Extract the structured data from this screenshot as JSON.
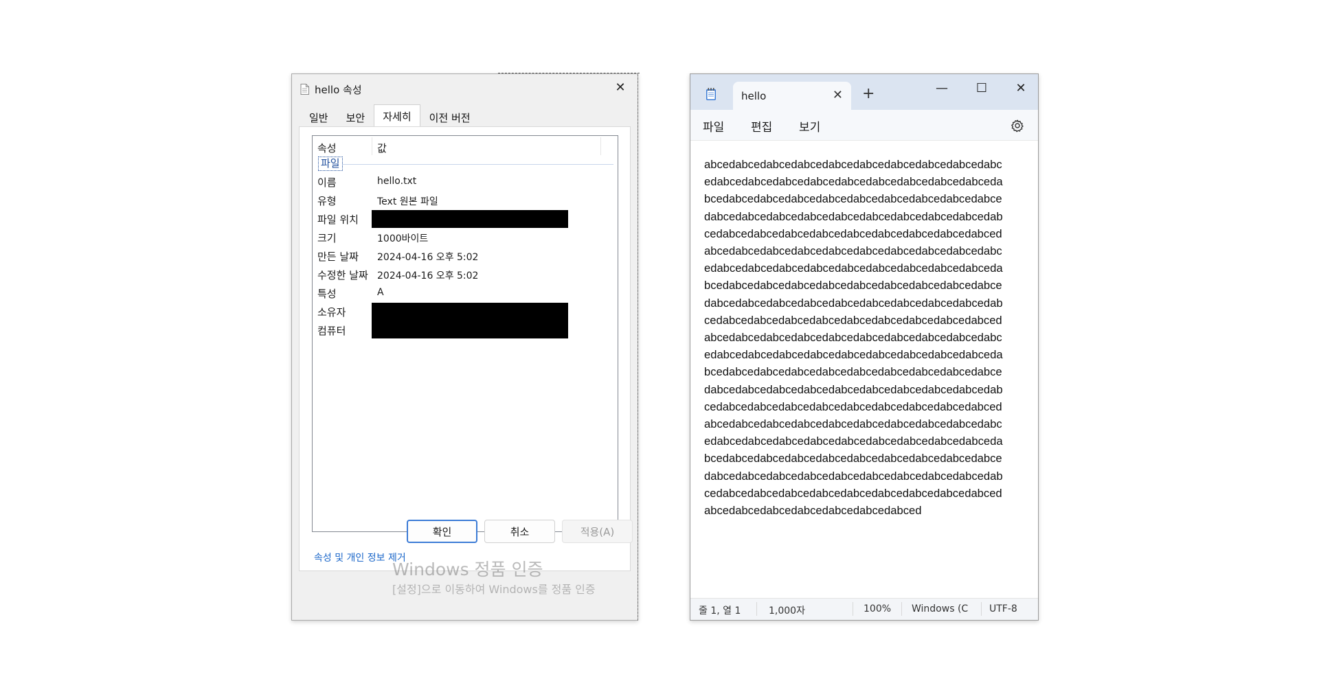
{
  "properties_dialog": {
    "title": "hello 속성",
    "close_glyph": "✕",
    "tabs": [
      {
        "label": "일반"
      },
      {
        "label": "보안"
      },
      {
        "label": "자세히"
      },
      {
        "label": "이전 버전"
      }
    ],
    "active_tab": "자세히",
    "columns": {
      "property": "속성",
      "value": "값"
    },
    "group_label": "파일",
    "rows": [
      {
        "key": "이름",
        "value": "hello.txt"
      },
      {
        "key": "유형",
        "value": "Text 원본 파일"
      },
      {
        "key": "파일 위치",
        "value": ""
      },
      {
        "key": "크기",
        "value": "1000바이트"
      },
      {
        "key": "만든 날짜",
        "value": "2024-04-16 오후 5:02"
      },
      {
        "key": "수정한 날짜",
        "value": "2024-04-16 오후 5:02"
      },
      {
        "key": "특성",
        "value": "A"
      },
      {
        "key": "소유자",
        "value": ""
      },
      {
        "key": "컴퓨터",
        "value": ""
      }
    ],
    "remove_link": "속성 및 개인 정보 제거",
    "buttons": {
      "ok": "확인",
      "cancel": "취소",
      "apply": "적용(A)"
    }
  },
  "watermark": {
    "line1": "Windows 정품 인증",
    "line2": "[설정]으로 이동하여 Windows를 정품 인증"
  },
  "notepad": {
    "tab_title": "hello",
    "tab_close_glyph": "✕",
    "new_tab_glyph": "+",
    "window_controls": {
      "minimize": "—",
      "maximize": "☐",
      "close": "✕"
    },
    "menus": [
      "파일",
      "편집",
      "보기"
    ],
    "text_lines": [
      "abcedabcedabcedabcedabcedabcedabcedabcedabcedabc",
      "edabcedabcedabcedabcedabcedabcedabcedabcedabceda",
      "bcedabcedabcedabcedabcedabcedabcedabcedabcedabce",
      "dabcedabcedabcedabcedabcedabcedabcedabcedabcedab",
      "cedabcedabcedabcedabcedabcedabcedabcedabcedabced",
      "abcedabcedabcedabcedabcedabcedabcedabcedabcedabc",
      "edabcedabcedabcedabcedabcedabcedabcedabcedabceda",
      "bcedabcedabcedabcedabcedabcedabcedabcedabcedabce",
      "dabcedabcedabcedabcedabcedabcedabcedabcedabcedab",
      "cedabcedabcedabcedabcedabcedabcedabcedabcedabced",
      "abcedabcedabcedabcedabcedabcedabcedabcedabcedabc",
      "edabcedabcedabcedabcedabcedabcedabcedabcedabceda",
      "bcedabcedabcedabcedabcedabcedabcedabcedabcedabce",
      "dabcedabcedabcedabcedabcedabcedabcedabcedabcedab",
      "cedabcedabcedabcedabcedabcedabcedabcedabcedabced",
      "abcedabcedabcedabcedabcedabcedabcedabcedabcedabc",
      "edabcedabcedabcedabcedabcedabcedabcedabcedabceda",
      "bcedabcedabcedabcedabcedabcedabcedabcedabcedabce",
      "dabcedabcedabcedabcedabcedabcedabcedabcedabcedab",
      "cedabcedabcedabcedabcedabcedabcedabcedabcedabced",
      "abcedabcedabcedabcedabcedabcedabced"
    ],
    "status": {
      "position": "줄 1, 열 1",
      "chars": "1,000자",
      "zoom": "100%",
      "line_ending": "Windows (C",
      "encoding": "UTF-8"
    }
  },
  "colors": {
    "link": "#1a66c9",
    "ok_border": "#3b7bd6",
    "notepad_titlebar": "#dbe4f1",
    "redaction": "#000000"
  },
  "icons": [
    "file-icon",
    "notepad-app-icon",
    "gear-icon",
    "close-icon",
    "minimize-icon",
    "maximize-icon",
    "plus-icon"
  ]
}
